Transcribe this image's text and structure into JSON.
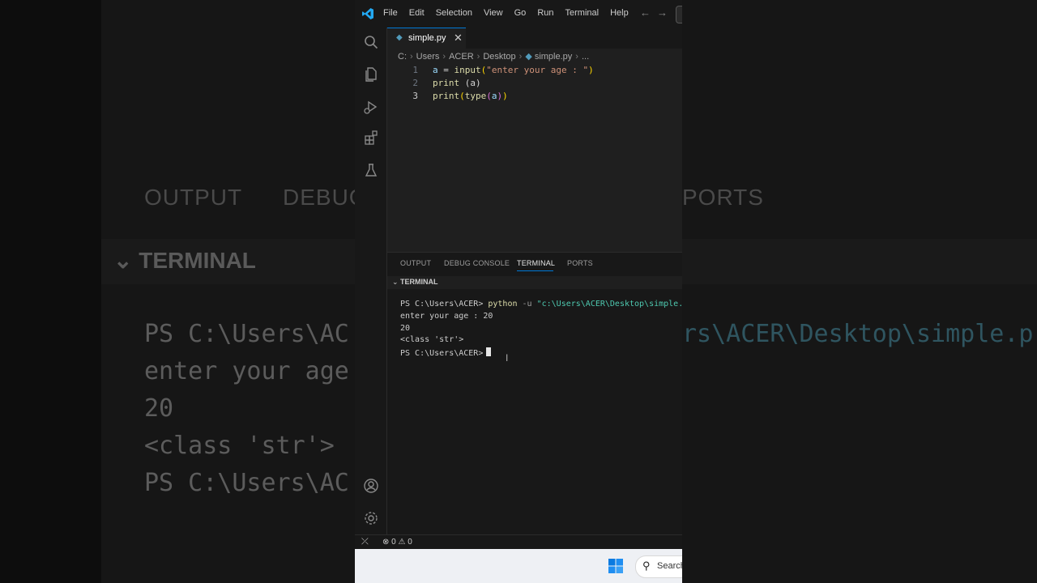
{
  "menu": [
    "File",
    "Edit",
    "Selection",
    "View",
    "Go",
    "Run",
    "Terminal",
    "Help"
  ],
  "tab": {
    "label": "simple.py",
    "close": "✕"
  },
  "breadcrumbs": [
    "C:",
    "Users",
    "ACER",
    "Desktop",
    "simple.py",
    "..."
  ],
  "editor": {
    "line_numbers": [
      "1",
      "2",
      "3"
    ],
    "line1": {
      "var": "a",
      "op": " = ",
      "fn": "input",
      "p1": "(",
      "str": "\"enter your age : \"",
      "p2": ")"
    },
    "line2": {
      "fn": "print",
      "rest": " (a)"
    },
    "line3": {
      "fn": "print",
      "p1": "(",
      "fn2": "type",
      "p2": "(",
      "arg": "a",
      "p3": ")",
      "p4": ")"
    }
  },
  "panel": {
    "tabs": [
      "OUTPUT",
      "DEBUG CONSOLE",
      "TERMINAL",
      "PORTS"
    ],
    "terminal_title": "TERMINAL",
    "lines": {
      "cmd_prompt": "PS C:\\Users\\ACER> ",
      "cmd": "python",
      "flag": " -u ",
      "path": "\"c:\\Users\\ACER\\Desktop\\simple.py\"",
      "out1": "enter your age : 20",
      "out2": "20",
      "out3": "<class 'str'>",
      "prompt": "PS C:\\Users\\ACER>"
    }
  },
  "status": {
    "errors": "0",
    "warnings": "0"
  },
  "taskbar": {
    "search": "Search"
  },
  "background": {
    "tab_output": "OUTPUT",
    "tab_debug": "DEBUG",
    "tab_ports": "PORTS",
    "terminal": "TERMINAL",
    "line1": "PS C:\\Users\\AC",
    "line2": "enter your age",
    "line3": "20",
    "line4": "<class 'str'>",
    "line5": "PS C:\\Users\\AC",
    "right": "rs\\ACER\\Desktop\\simple.p"
  },
  "colors": {
    "accent": "#0078d4",
    "python_icon": "#519aba"
  }
}
